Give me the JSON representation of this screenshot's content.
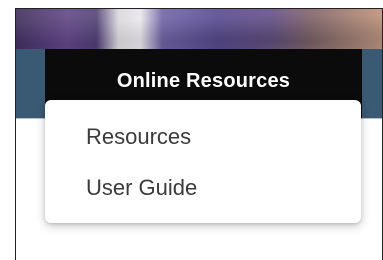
{
  "nav": {
    "active_tab": "Online Resources"
  },
  "dropdown": {
    "items": [
      {
        "label": "Resources"
      },
      {
        "label": "User Guide"
      }
    ]
  },
  "colors": {
    "navbar_bg": "#3a5a73",
    "active_tab_bg": "#0b0b0b",
    "active_tab_text": "#ffffff",
    "menu_text": "#3b3b3b"
  }
}
